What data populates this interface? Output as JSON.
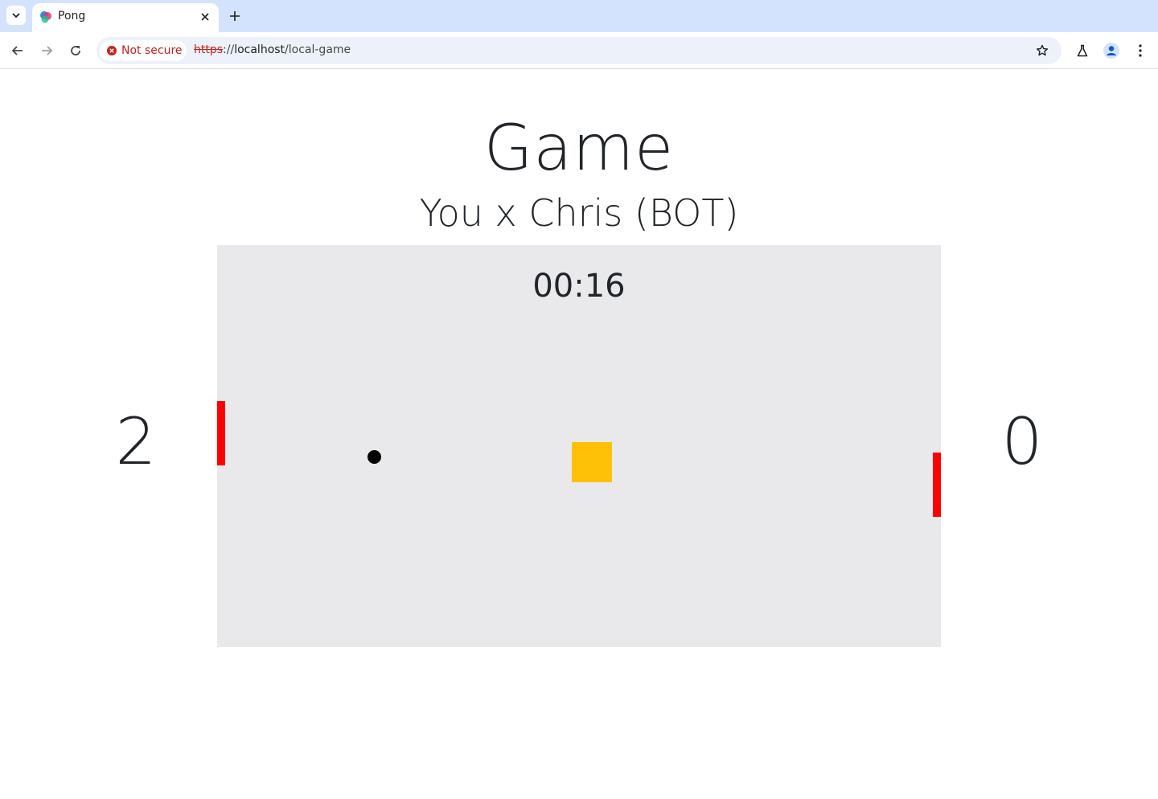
{
  "browser": {
    "tab_title": "Pong",
    "security_label": "Not secure",
    "url_scheme": "https",
    "url_separator": "://",
    "url_host": "localhost",
    "url_path": "/local-game"
  },
  "page": {
    "title": "Game",
    "matchup": "You x Chris (BOT)",
    "timer": "00:16",
    "score_left": "2",
    "score_right": "0"
  },
  "colors": {
    "board": "#e9e9ec",
    "paddle": "#ff0000",
    "ball": "#000000",
    "powerup": "#fec107",
    "text": "#212529"
  },
  "icons": [
    "tab-search-icon",
    "pong-favicon-icon",
    "close-icon",
    "new-tab-icon",
    "back-icon",
    "forward-icon",
    "reload-icon",
    "not-secure-icon",
    "bookmark-star-icon",
    "labs-flask-icon",
    "profile-icon",
    "more-menu-icon"
  ]
}
